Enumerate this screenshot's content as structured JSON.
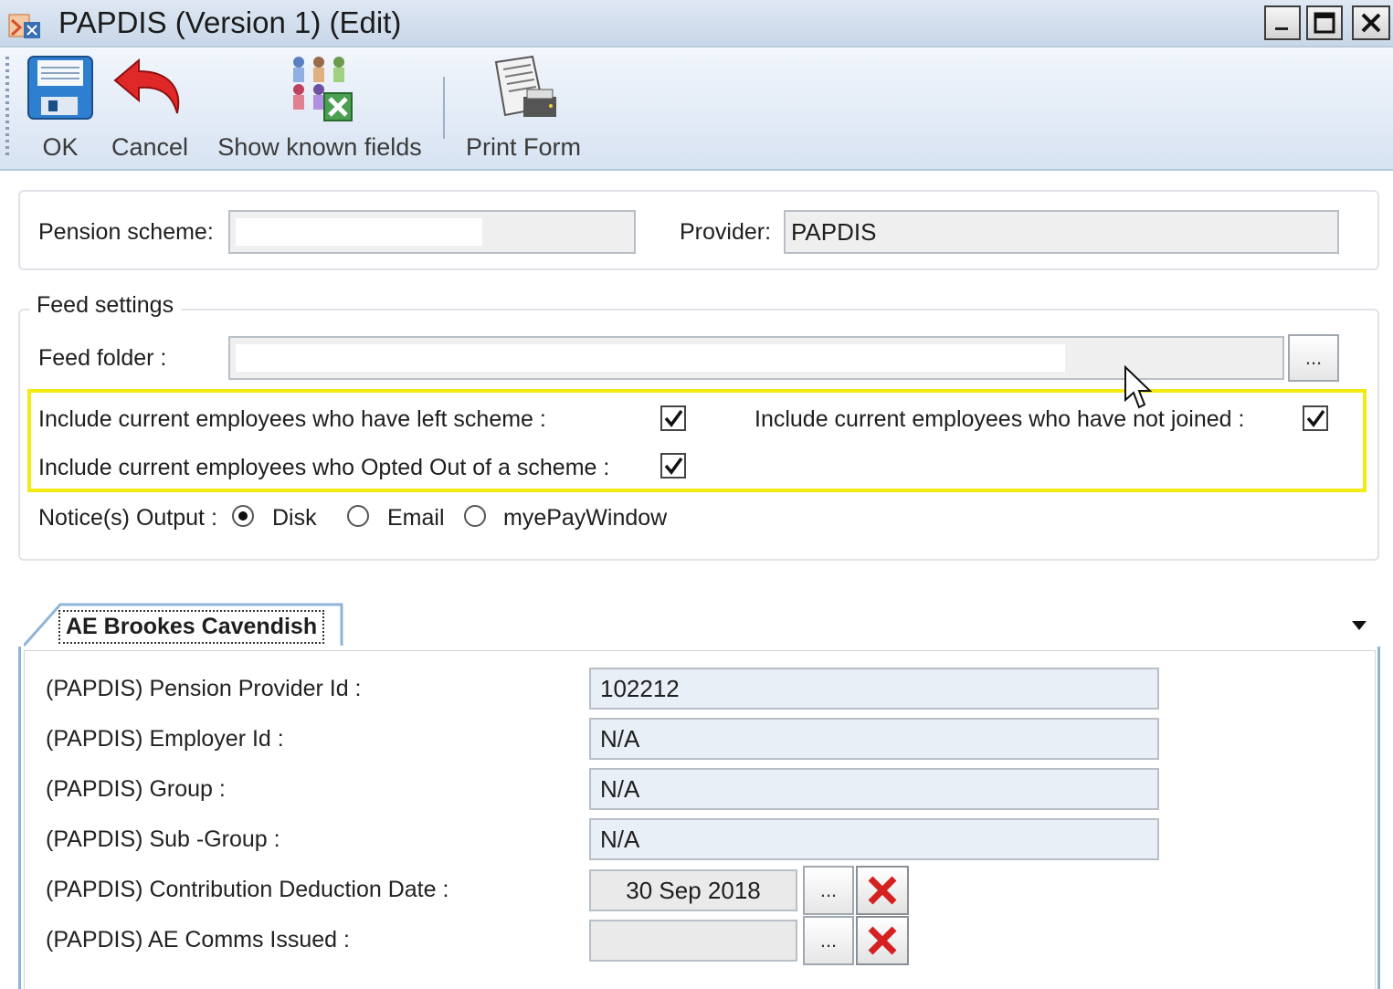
{
  "window": {
    "title": "PAPDIS (Version 1) (Edit)",
    "minimize_label": "_",
    "maximize_label": "□",
    "close_label": "✕"
  },
  "toolbar": {
    "ok_label": "OK",
    "cancel_label": "Cancel",
    "show_fields_label": "Show known fields",
    "print_label": "Print Form"
  },
  "scheme": {
    "pension_label": "Pension scheme:",
    "pension_value": "",
    "provider_label": "Provider:",
    "provider_value": "PAPDIS"
  },
  "feed": {
    "title": "Feed settings",
    "folder_label": "Feed folder :",
    "folder_value": "",
    "browse_label": "...",
    "left_scheme_label": "Include current employees who have left scheme :",
    "left_scheme_checked": true,
    "not_joined_label": "Include current employees who have not joined :",
    "not_joined_checked": true,
    "opted_out_label": "Include current employees who Opted Out of a scheme :",
    "opted_out_checked": true,
    "notice_label": "Notice(s) Output :",
    "notice_options": [
      "Disk",
      "Email",
      "myePayWindow"
    ],
    "notice_selected": "Disk"
  },
  "tab": {
    "caption": "AE Brookes Cavendish",
    "fields": [
      {
        "label": "(PAPDIS) Pension Provider Id :",
        "value": "102212"
      },
      {
        "label": "(PAPDIS) Employer Id :",
        "value": "N/A"
      },
      {
        "label": "(PAPDIS) Group :",
        "value": "N/A"
      },
      {
        "label": "(PAPDIS) Sub -Group :",
        "value": "N/A"
      }
    ],
    "contribution_date_label": "(PAPDIS) Contribution Deduction Date :",
    "contribution_date_value": "30 Sep 2018",
    "comms_issued_label": "(PAPDIS) AE Comms Issued :",
    "comms_issued_value": "",
    "date_browse_label": "..."
  },
  "colors": {
    "highlight": "#f2ea12",
    "clear_red": "#d42020",
    "tab_border": "#8fb4d8"
  }
}
